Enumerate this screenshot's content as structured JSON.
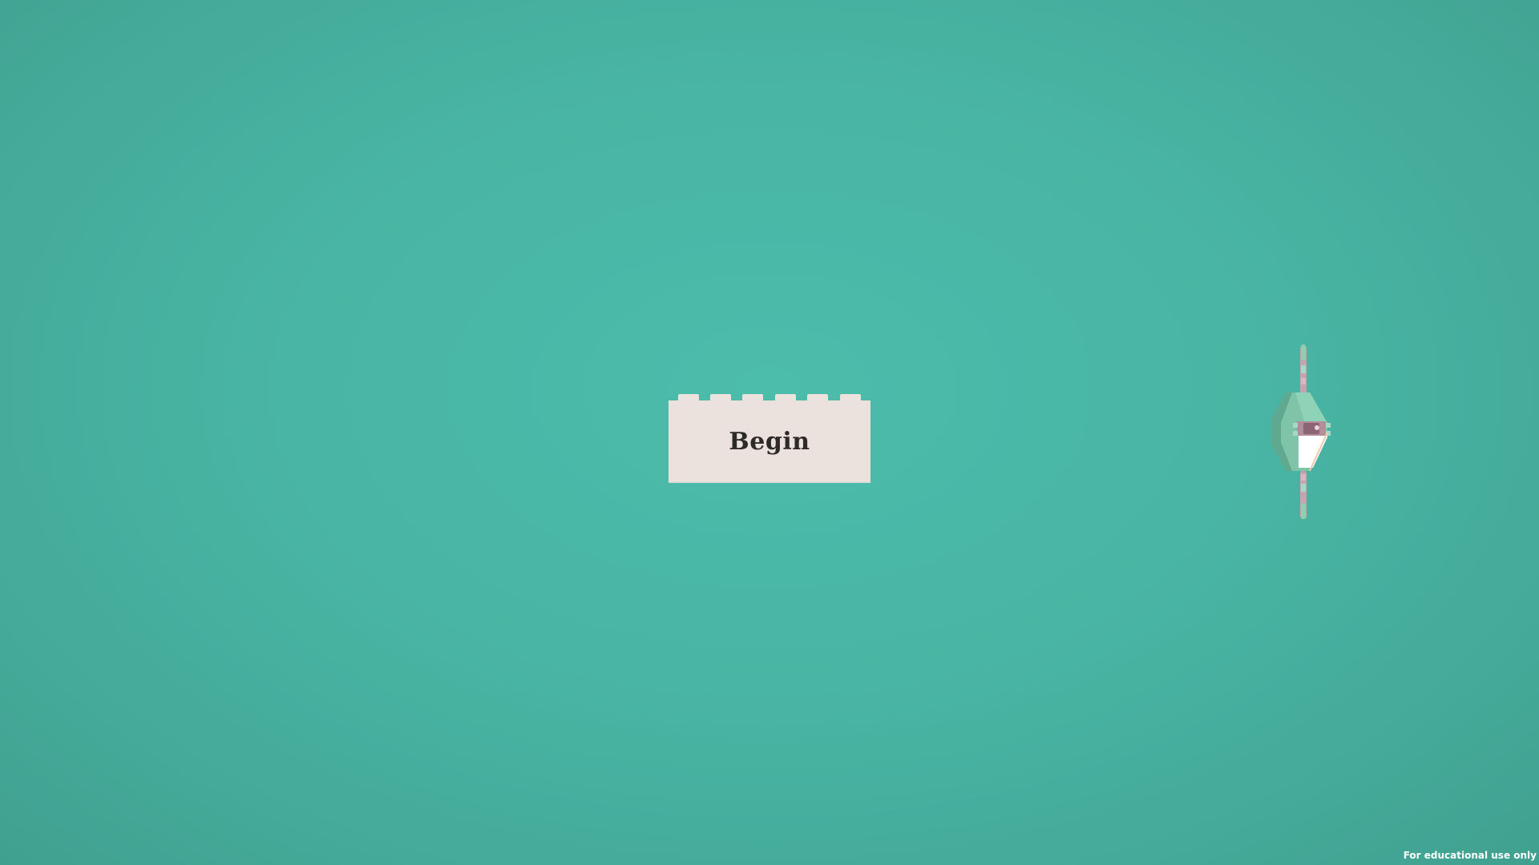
{
  "menu": {
    "begin_label": "Begin"
  },
  "footer": {
    "notice": "For educational use only"
  },
  "colors": {
    "background": "#4ab8a7",
    "brick": "#ebe2de",
    "label": "#2e2a28"
  },
  "icons": {
    "ship": "spaceship-model"
  }
}
